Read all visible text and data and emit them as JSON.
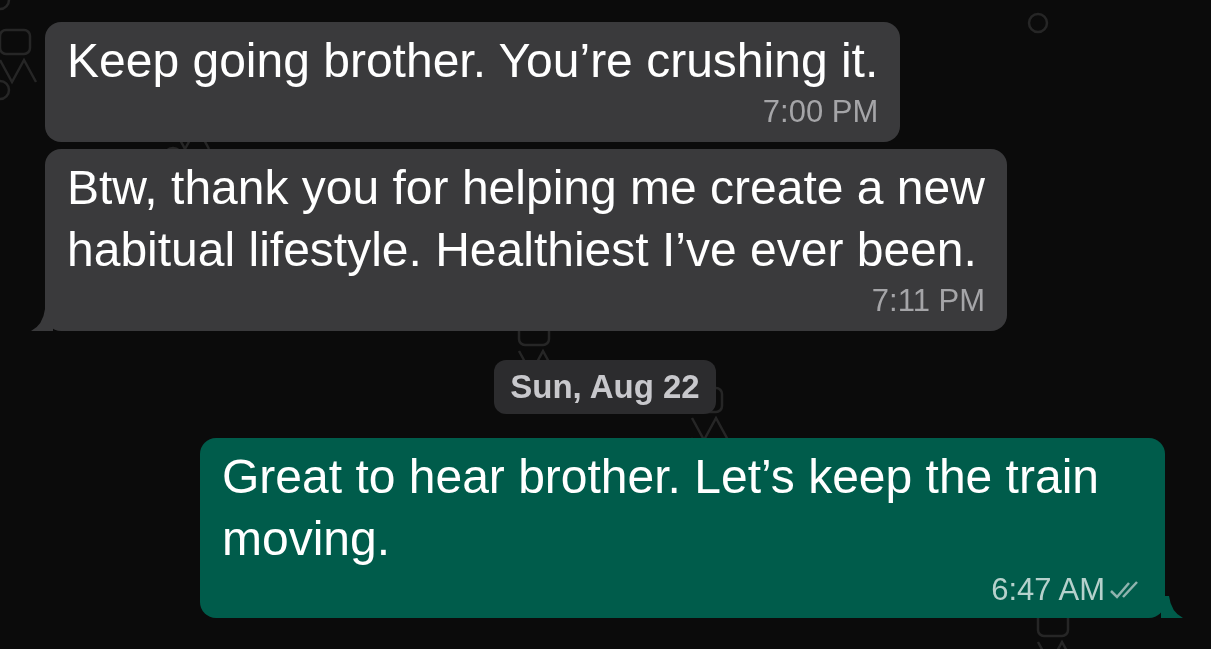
{
  "messages": [
    {
      "kind": "incoming",
      "text": "Keep going brother. You’re crushing it.",
      "time": "7:00 PM",
      "tail": false
    },
    {
      "kind": "incoming",
      "text": "Btw, thank you for helping me create a new habitual lifestyle. Healthiest I’ve ever been.",
      "time": "7:11 PM",
      "tail": true
    },
    {
      "kind": "date",
      "text": "Sun, Aug 22"
    },
    {
      "kind": "outgoing",
      "text": "Great to hear brother. Let’s keep the train moving.",
      "time": "6:47 AM",
      "tail": true,
      "read": false
    }
  ]
}
